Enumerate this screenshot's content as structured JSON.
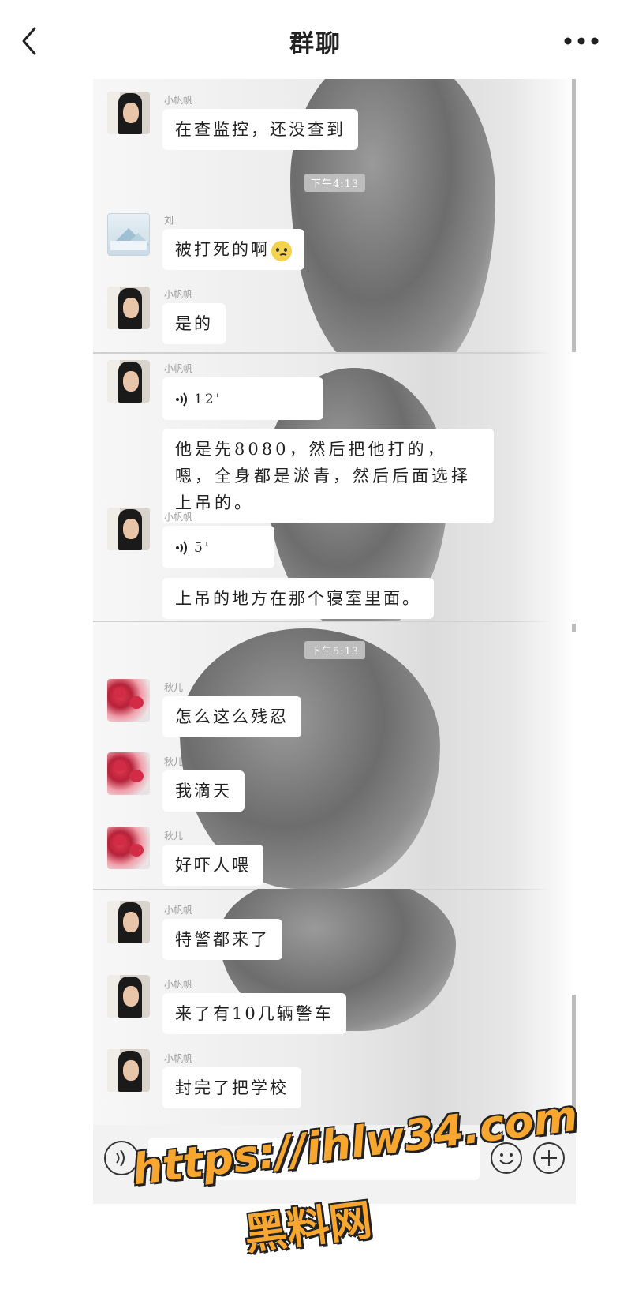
{
  "header": {
    "title": "群聊",
    "back_icon": "chevron-left-icon",
    "more_icon": "more-horizontal-icon"
  },
  "chat": {
    "timestamps": [
      "下午4:13",
      "下午5:13"
    ],
    "messages": [
      {
        "sender": "小帆帆",
        "avatar": "avatar-girl",
        "text": "在查监控，还没查到"
      },
      {
        "sender": "刘",
        "avatar": "avatar-scenery",
        "text": "被打死的啊",
        "emoji": "pleading-face-emoji"
      },
      {
        "sender": "小帆帆",
        "avatar": "avatar-girl",
        "text": "是的"
      },
      {
        "sender": "小帆帆",
        "avatar": "avatar-girl",
        "voice": "12'"
      },
      {
        "sender": "",
        "avatar": "",
        "text": "他是先8080，然后把他打的，嗯，全身都是淤青，然后后面选择上吊的。"
      },
      {
        "sender": "小帆帆",
        "avatar": "avatar-girl",
        "voice": "5'"
      },
      {
        "sender": "",
        "avatar": "",
        "text": "上吊的地方在那个寝室里面。"
      },
      {
        "sender": "秋儿",
        "avatar": "avatar-flower",
        "text": "怎么这么残忍"
      },
      {
        "sender": "秋儿",
        "avatar": "avatar-flower",
        "text": "我滴天"
      },
      {
        "sender": "秋儿",
        "avatar": "avatar-flower",
        "text": "好吓人喂"
      },
      {
        "sender": "小帆帆",
        "avatar": "avatar-girl",
        "text": "特警都来了"
      },
      {
        "sender": "小帆帆",
        "avatar": "avatar-girl",
        "text": "来了有10几辆警车"
      },
      {
        "sender": "小帆帆",
        "avatar": "avatar-girl",
        "text": "封完了把学校"
      }
    ]
  },
  "input_bar": {
    "voice_icon": "voice-icon",
    "emoji_icon": "smiley-icon",
    "plus_icon": "plus-icon"
  },
  "watermark": {
    "line1": "https://ihlw34.com",
    "line2": "黑料网",
    "color": "#f7a72f"
  }
}
